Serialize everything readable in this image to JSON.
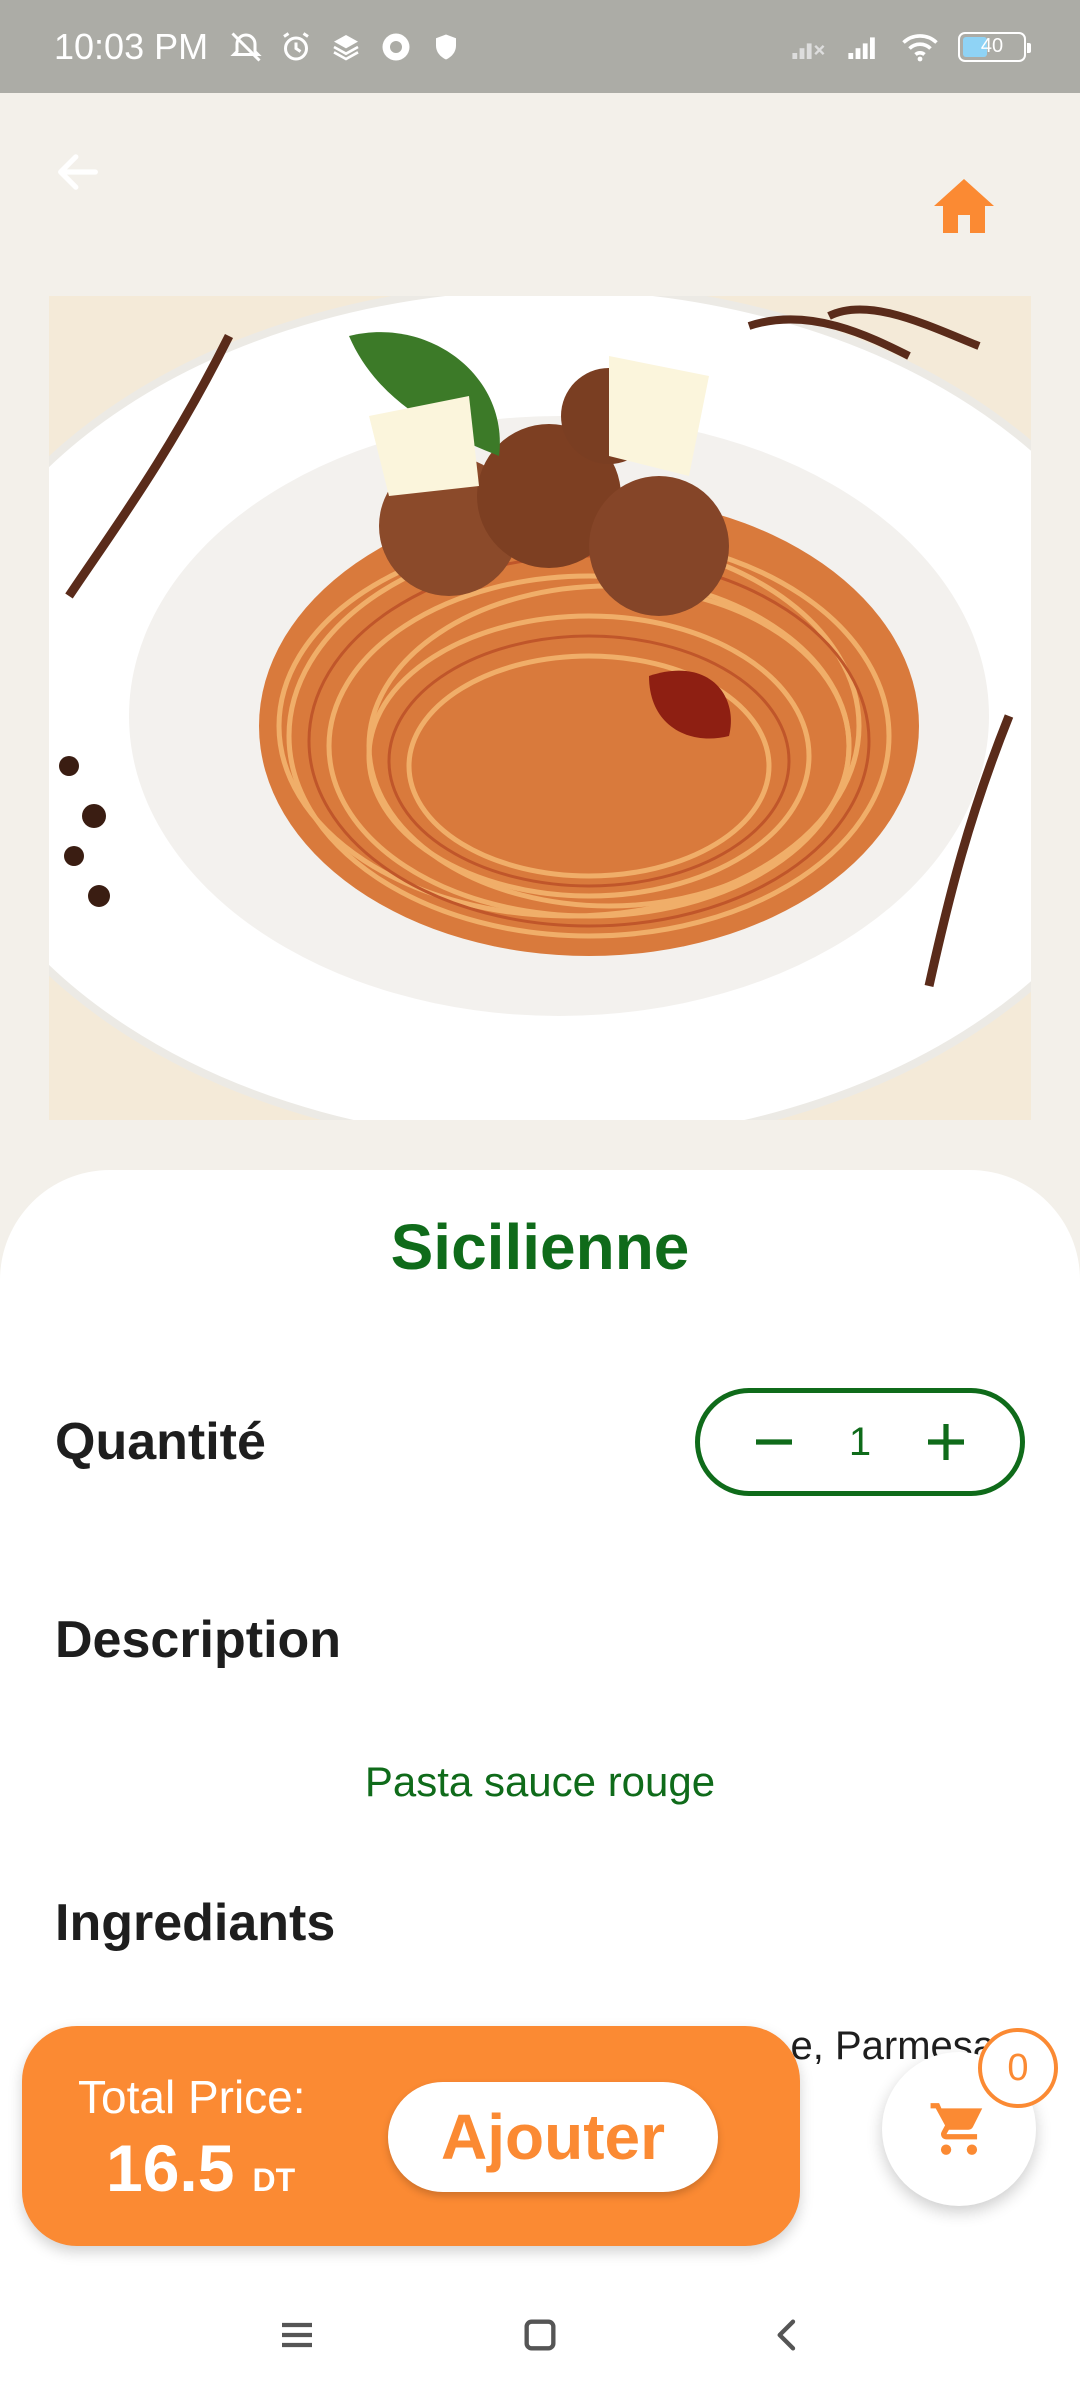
{
  "status_bar": {
    "time": "10:03 PM",
    "left_icons": [
      "do-not-disturb-icon",
      "alarm-icon",
      "layers-icon",
      "browser-icon",
      "shield-icon"
    ],
    "battery_level": "40",
    "right_icons": [
      "signal-off-icon",
      "signal-icon",
      "wifi-icon",
      "battery-icon"
    ]
  },
  "header": {
    "back_icon": "arrow-left-icon",
    "home_icon": "home-icon"
  },
  "product": {
    "image_alt": "spaghetti with meatballs",
    "title": "Sicilienne",
    "quantity_label": "Quantité",
    "quantity_value": "1",
    "description_title": "Description",
    "description": "Pasta sauce rouge",
    "ingredients_title": "Ingrediants",
    "ingredients": "e, Parmesa"
  },
  "order_bar": {
    "total_label": "Total Price:",
    "price": "16.5",
    "currency": "DT",
    "add_label": "Ajouter"
  },
  "cart": {
    "count": "0"
  },
  "colors": {
    "accent_orange": "#fb8a33",
    "accent_green": "#0f6b1a",
    "background": "#f3f0ea"
  },
  "nav": [
    "menu-icon",
    "home-square-icon",
    "back-chevron-icon"
  ]
}
